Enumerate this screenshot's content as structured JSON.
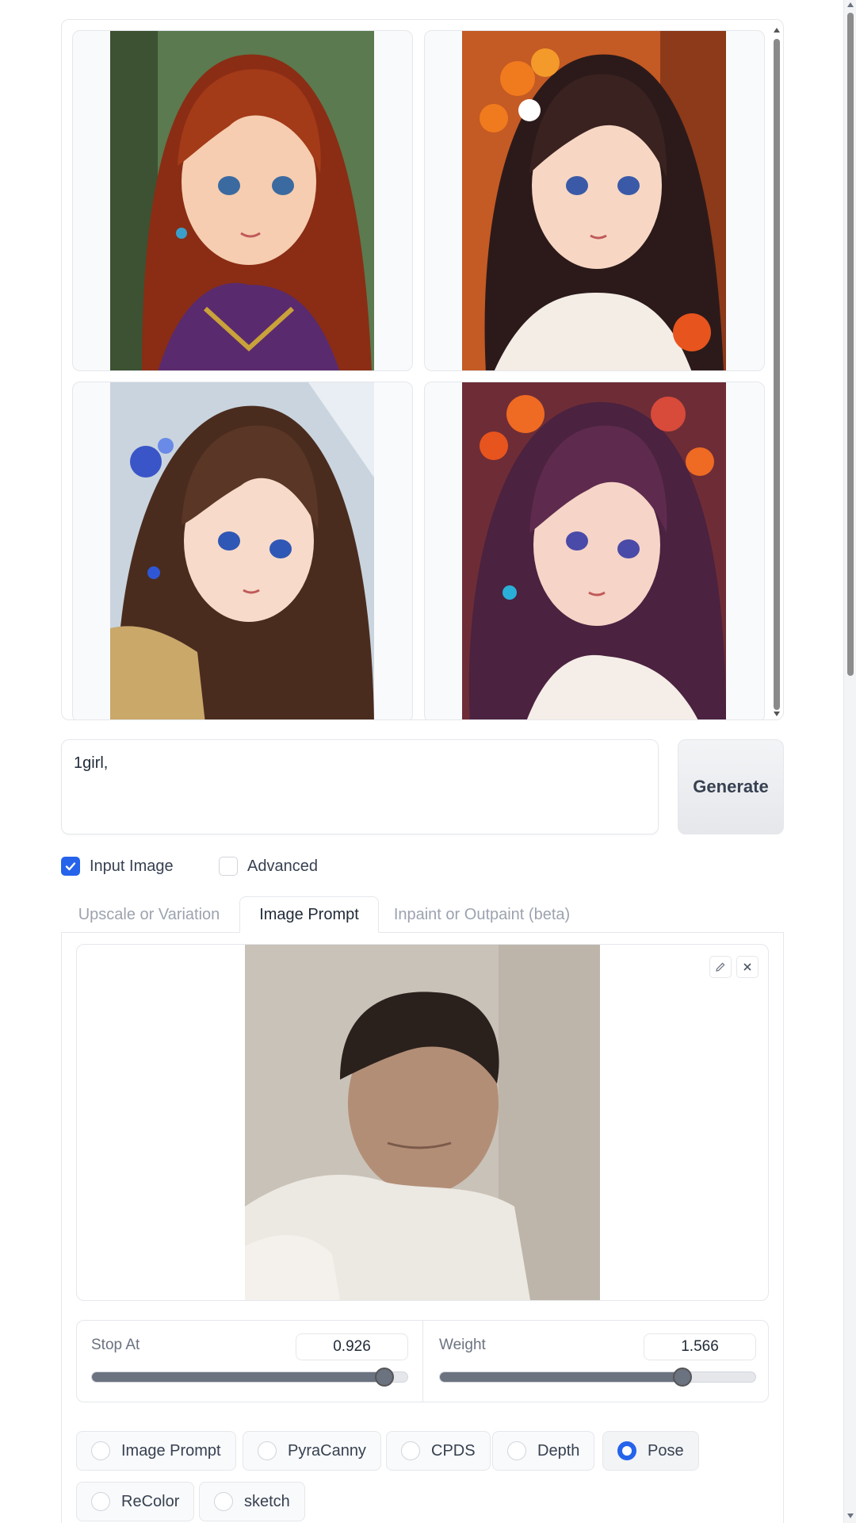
{
  "gallery": {
    "images": [
      {
        "name": "girl-auburn-hair",
        "hair": "#8a2d14",
        "bg": "#5b7a4f"
      },
      {
        "name": "girl-orange-flowers",
        "hair": "#2c1a1a",
        "bg": "#c45a24"
      },
      {
        "name": "girl-blue-jewel",
        "hair": "#4a2c1e",
        "bg": "#c9d4de"
      },
      {
        "name": "girl-violet-hair",
        "hair": "#4b2240",
        "bg": "#6e2d36"
      }
    ]
  },
  "prompt": {
    "value": "1girl,"
  },
  "generate": {
    "label": "Generate"
  },
  "options": {
    "input_image": {
      "label": "Input Image",
      "checked": true
    },
    "advanced": {
      "label": "Advanced",
      "checked": false
    }
  },
  "tabs": [
    {
      "label": "Upscale or Variation",
      "active": false
    },
    {
      "label": "Image Prompt",
      "active": true
    },
    {
      "label": "Inpaint or Outpaint (beta)",
      "active": false
    }
  ],
  "image_prompt": {
    "stop_at": {
      "label": "Stop At",
      "value": "0.926",
      "fraction": 0.926
    },
    "weight": {
      "label": "Weight",
      "value": "1.566",
      "fraction": 0.768
    },
    "types": [
      {
        "label": "Image Prompt",
        "selected": false
      },
      {
        "label": "PyraCanny",
        "selected": false
      },
      {
        "label": "CPDS",
        "selected": false
      },
      {
        "label": "Depth",
        "selected": false
      },
      {
        "label": "Pose",
        "selected": true
      },
      {
        "label": "ReColor",
        "selected": false
      },
      {
        "label": "sketch",
        "selected": false
      }
    ]
  },
  "colors": {
    "accent": "#2563eb",
    "slider": "#6b7280"
  }
}
